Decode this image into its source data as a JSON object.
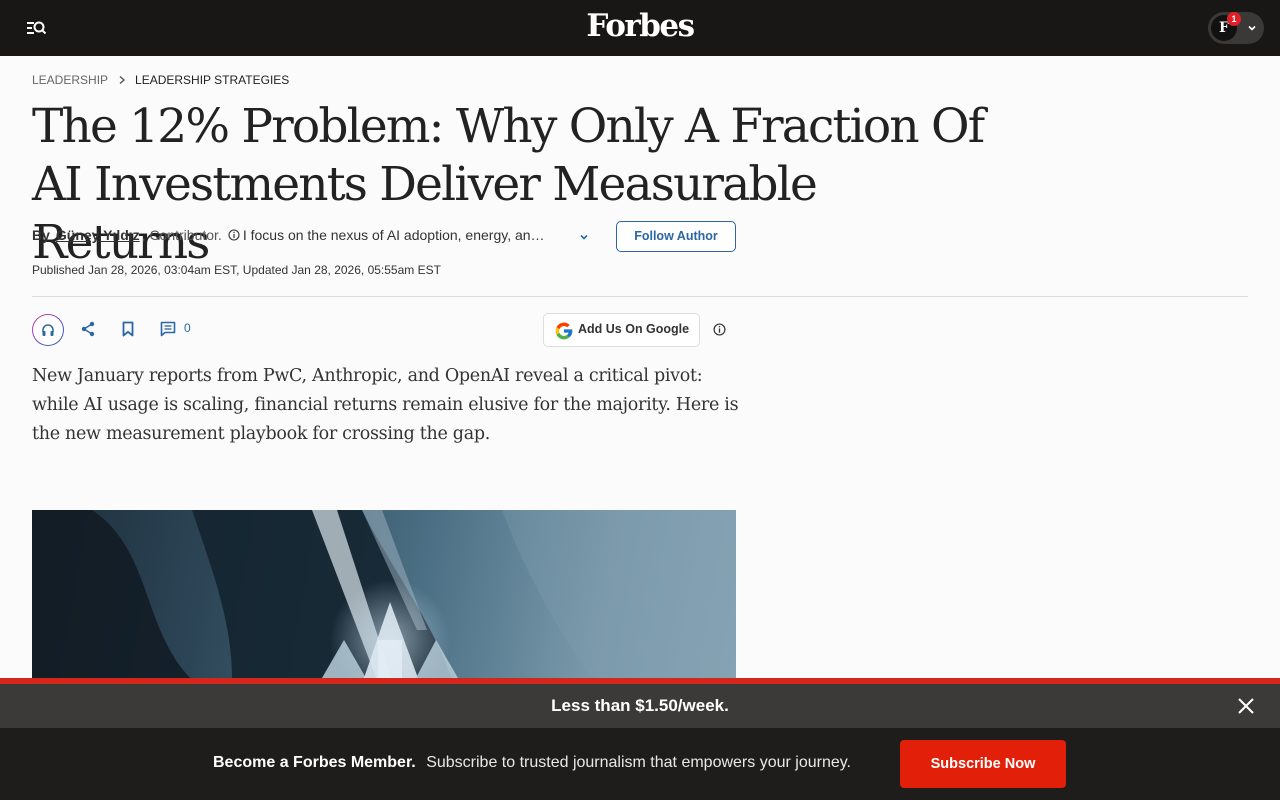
{
  "header": {
    "logo": "Forbes",
    "account_initial": "F",
    "notification_count": "1"
  },
  "breadcrumb": [
    "LEADERSHIP",
    "LEADERSHIP STRATEGIES"
  ],
  "article": {
    "headline": "The 12% Problem: Why Only A Fraction Of AI Investments Deliver Measurable Returns",
    "by_label": "By",
    "author": "Güney Yıldız",
    "role": ", Contributor.",
    "bio": "I focus on the nexus of AI adoption, energy, and geopolitics.",
    "follow_label": "Follow Author",
    "published": "Published Jan 28, 2026, 03:04am EST, Updated Jan 28, 2026, 05:55am EST",
    "comment_count": "0",
    "google_label": "Add Us On Google",
    "dek": "New January reports from PwC, Anthropic, and OpenAI reveal a critical pivot: while AI usage is scaling, financial returns remain elusive for the majority. Here is the new measurement playbook for crossing the gap."
  },
  "promo": {
    "headline": "Less than $1.50/week.",
    "lead": "Become a Forbes Member.",
    "text": "Subscribe to trusted journalism that empowers your journey.",
    "cta": "Subscribe Now"
  },
  "icons": {
    "menu": "menu-search-icon",
    "chevron": "chevron-down-icon",
    "info": "info-icon",
    "headphones": "headphones-icon",
    "share": "share-icon",
    "bookmark": "bookmark-icon",
    "comment": "comment-icon",
    "google": "google-logo-icon",
    "close": "close-icon"
  },
  "colors": {
    "topbar": "#181716",
    "link_blue": "#2a67a4",
    "promo_red": "#e21f08",
    "promo_strip": "#3b3a39",
    "promo_bottom": "#1f1d1c"
  }
}
